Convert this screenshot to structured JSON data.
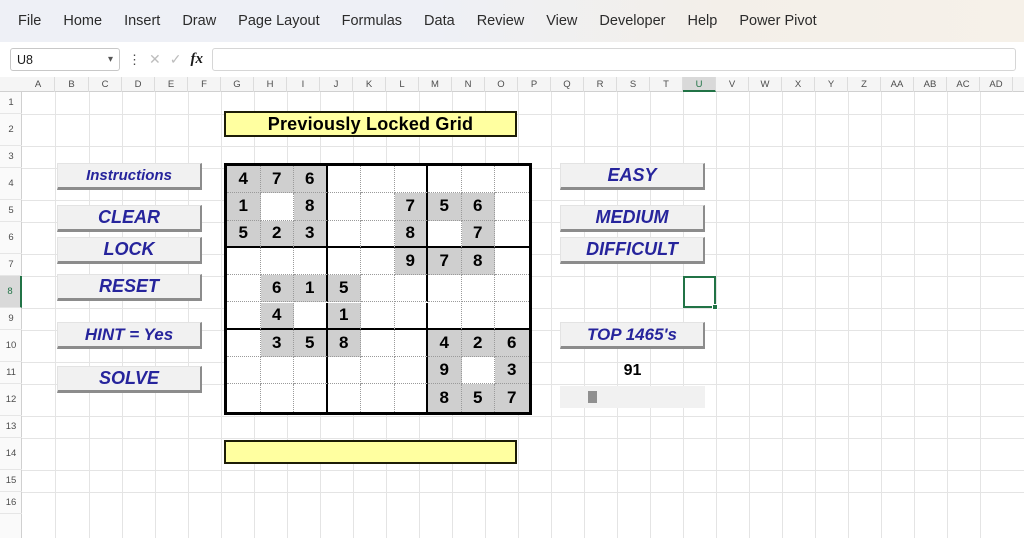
{
  "ribbon": {
    "tabs": [
      {
        "label": "File"
      },
      {
        "label": "Home"
      },
      {
        "label": "Insert"
      },
      {
        "label": "Draw"
      },
      {
        "label": "Page Layout"
      },
      {
        "label": "Formulas"
      },
      {
        "label": "Data"
      },
      {
        "label": "Review"
      },
      {
        "label": "View"
      },
      {
        "label": "Developer"
      },
      {
        "label": "Help"
      },
      {
        "label": "Power Pivot"
      }
    ]
  },
  "formula_bar": {
    "name_box_value": "U8",
    "name_box_chevron": "chevron-down-icon",
    "cancel_icon": "✕",
    "confirm_icon": "✓",
    "fx_label": "fx",
    "formula_value": ""
  },
  "sheet": {
    "columns": [
      "A",
      "B",
      "C",
      "D",
      "E",
      "F",
      "G",
      "H",
      "I",
      "J",
      "K",
      "L",
      "M",
      "N",
      "O",
      "P",
      "Q",
      "R",
      "S",
      "T",
      "U",
      "V",
      "W",
      "X",
      "Y",
      "Z",
      "AA",
      "AB",
      "AC",
      "AD"
    ],
    "selected_column": "U",
    "rows": [
      "1",
      "2",
      "3",
      "4",
      "5",
      "6",
      "7",
      "8",
      "9",
      "10",
      "11",
      "12",
      "13",
      "14",
      "15",
      "16"
    ],
    "selected_row": "8",
    "selected_cell": "U8"
  },
  "title_banner": {
    "text": "Previously Locked Grid"
  },
  "bottom_banner": {
    "text": ""
  },
  "left_buttons": [
    {
      "label": "Instructions",
      "font_size": 15
    },
    {
      "label": "CLEAR",
      "font_size": 18
    },
    {
      "label": "LOCK",
      "font_size": 18
    },
    {
      "label": "RESET",
      "font_size": 18
    },
    {
      "label": "HINT = Yes",
      "font_size": 17
    },
    {
      "label": "SOLVE",
      "font_size": 18
    }
  ],
  "right_buttons": [
    {
      "label": "EASY",
      "font_size": 18
    },
    {
      "label": "MEDIUM",
      "font_size": 18
    },
    {
      "label": "DIFFICULT",
      "font_size": 18
    },
    {
      "label": "TOP 1465's",
      "font_size": 17
    }
  ],
  "counter": {
    "value": "91"
  },
  "colors": {
    "button_text": "#26249c",
    "banner_fill": "#ffffa0",
    "cell_fill": "#cfcfcf",
    "selection": "#217346"
  },
  "sudoku": {
    "rows": [
      [
        {
          "v": "4",
          "f": true
        },
        {
          "v": "7",
          "f": true
        },
        {
          "v": "6",
          "f": true
        },
        {
          "v": "",
          "f": false
        },
        {
          "v": "",
          "f": false
        },
        {
          "v": "",
          "f": false
        },
        {
          "v": "",
          "f": false
        },
        {
          "v": "",
          "f": false
        },
        {
          "v": "",
          "f": false
        }
      ],
      [
        {
          "v": "1",
          "f": true
        },
        {
          "v": "",
          "f": false
        },
        {
          "v": "8",
          "f": true
        },
        {
          "v": "",
          "f": false
        },
        {
          "v": "",
          "f": false
        },
        {
          "v": "7",
          "f": true
        },
        {
          "v": "5",
          "f": true
        },
        {
          "v": "6",
          "f": true
        },
        {
          "v": "",
          "f": false
        }
      ],
      [
        {
          "v": "5",
          "f": true
        },
        {
          "v": "2",
          "f": true
        },
        {
          "v": "3",
          "f": true
        },
        {
          "v": "",
          "f": false
        },
        {
          "v": "",
          "f": false
        },
        {
          "v": "8",
          "f": true
        },
        {
          "v": "",
          "f": false
        },
        {
          "v": "7",
          "f": true
        },
        {
          "v": "",
          "f": false
        }
      ],
      [
        {
          "v": "",
          "f": false
        },
        {
          "v": "",
          "f": false
        },
        {
          "v": "",
          "f": false
        },
        {
          "v": "",
          "f": false
        },
        {
          "v": "",
          "f": false
        },
        {
          "v": "9",
          "f": true
        },
        {
          "v": "7",
          "f": true
        },
        {
          "v": "8",
          "f": true
        },
        {
          "v": "",
          "f": false
        }
      ],
      [
        {
          "v": "",
          "f": false
        },
        {
          "v": "6",
          "f": true
        },
        {
          "v": "1",
          "f": true
        },
        {
          "v": "5",
          "f": true
        },
        {
          "v": "",
          "f": false
        },
        {
          "v": "",
          "f": false
        },
        {
          "v": "",
          "f": false
        },
        {
          "v": "",
          "f": false
        },
        {
          "v": "",
          "f": false
        }
      ],
      [
        {
          "v": "",
          "f": false
        },
        {
          "v": "4",
          "f": true
        },
        {
          "v": "",
          "f": false
        },
        {
          "v": "1",
          "f": true
        },
        {
          "v": "",
          "f": false
        },
        {
          "v": "",
          "f": false
        },
        {
          "v": "",
          "f": false
        },
        {
          "v": "",
          "f": false
        },
        {
          "v": "",
          "f": false
        }
      ],
      [
        {
          "v": "",
          "f": false
        },
        {
          "v": "3",
          "f": true
        },
        {
          "v": "5",
          "f": true
        },
        {
          "v": "8",
          "f": true
        },
        {
          "v": "",
          "f": false
        },
        {
          "v": "",
          "f": false
        },
        {
          "v": "4",
          "f": true
        },
        {
          "v": "2",
          "f": true
        },
        {
          "v": "6",
          "f": true
        }
      ],
      [
        {
          "v": "",
          "f": false
        },
        {
          "v": "",
          "f": false
        },
        {
          "v": "",
          "f": false
        },
        {
          "v": "",
          "f": false
        },
        {
          "v": "",
          "f": false
        },
        {
          "v": "",
          "f": false
        },
        {
          "v": "9",
          "f": true
        },
        {
          "v": "",
          "f": false
        },
        {
          "v": "3",
          "f": true
        }
      ],
      [
        {
          "v": "",
          "f": false
        },
        {
          "v": "",
          "f": false
        },
        {
          "v": "",
          "f": false
        },
        {
          "v": "",
          "f": false
        },
        {
          "v": "",
          "f": false
        },
        {
          "v": "",
          "f": false
        },
        {
          "v": "8",
          "f": true
        },
        {
          "v": "5",
          "f": true
        },
        {
          "v": "7",
          "f": true
        }
      ]
    ]
  }
}
